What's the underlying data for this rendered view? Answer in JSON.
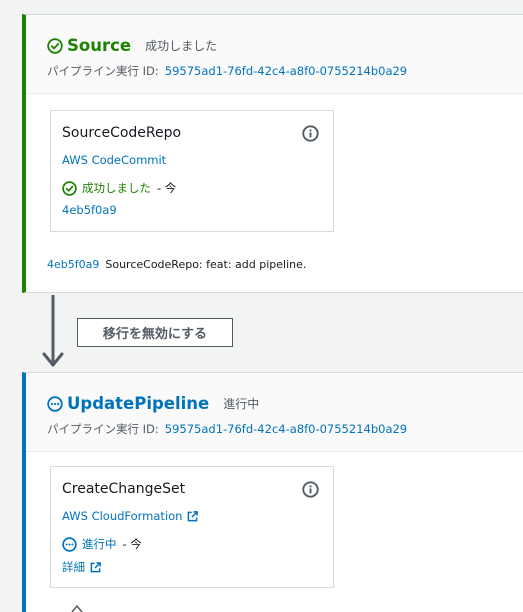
{
  "stages": {
    "source": {
      "title": "Source",
      "status": "成功しました",
      "exec_label": "パイプライン実行 ID:",
      "exec_id": "59575ad1-76fd-42c4-a8f0-0755214b0a29",
      "action": {
        "name": "SourceCodeRepo",
        "provider": "AWS CodeCommit",
        "status": "成功しました",
        "time": "- 今",
        "revision": "4eb5f0a9"
      },
      "commit": {
        "id": "4eb5f0a9",
        "message": "SourceCodeRepo: feat: add pipeline."
      }
    },
    "update": {
      "title": "UpdatePipeline",
      "status": "進行中",
      "exec_label": "パイプライン実行 ID:",
      "exec_id": "59575ad1-76fd-42c4-a8f0-0755214b0a29",
      "action": {
        "name": "CreateChangeSet",
        "provider": "AWS CloudFormation",
        "status": "進行中",
        "time": "- 今",
        "details": "詳細"
      }
    }
  },
  "transition": {
    "button_label": "移行を無効にする"
  },
  "colors": {
    "success": "#1d8102",
    "in_progress": "#0073bb",
    "link": "#0073bb"
  },
  "icons": [
    "check-circle-icon",
    "in-progress-icon",
    "info-icon",
    "external-link-icon",
    "arrow-down-icon"
  ]
}
